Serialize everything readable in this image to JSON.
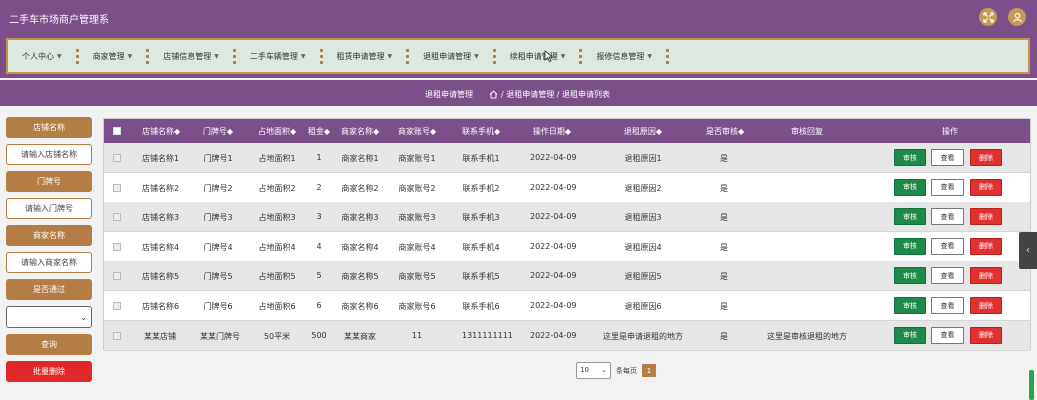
{
  "app": {
    "title": "二手车市场商户管理系"
  },
  "top_icons": [
    "fullscreen-icon",
    "user-icon"
  ],
  "nav": [
    {
      "label": "个人中心"
    },
    {
      "label": "商家管理"
    },
    {
      "label": "店铺信息管理"
    },
    {
      "label": "二手车辆管理"
    },
    {
      "label": "租赁申请管理"
    },
    {
      "label": "退租申请管理"
    },
    {
      "label": "续租申请管理"
    },
    {
      "label": "报修信息管理"
    }
  ],
  "breadcrumb": {
    "section": "退租申请管理",
    "path": "/ 退租申请管理 / 退租申请列表"
  },
  "search": {
    "shop_name_label": "店铺名称",
    "shop_name_placeholder": "请输入店铺名称",
    "door_no_label": "门牌号",
    "door_no_placeholder": "请输入门牌号",
    "merchant_name_label": "商家名称",
    "merchant_name_placeholder": "请输入商家名称",
    "passed_label": "是否通过",
    "passed_value": "",
    "query_button": "查询",
    "batch_delete_button": "批量删除"
  },
  "table": {
    "columns": [
      "店铺名称◆",
      "门牌号◆",
      "占地面积◆",
      "租金◆",
      "商家名称◆",
      "商家账号◆",
      "联系手机◆",
      "操作日期◆",
      "退租原因◆",
      "是否审核◆",
      "审核回复",
      "操作"
    ],
    "rows": [
      [
        "店铺名称1",
        "门牌号1",
        "占地面积1",
        "1",
        "商家名称1",
        "商家账号1",
        "联系手机1",
        "2022-04-09",
        "退租原因1",
        "是",
        ""
      ],
      [
        "店铺名称2",
        "门牌号2",
        "占地面积2",
        "2",
        "商家名称2",
        "商家账号2",
        "联系手机2",
        "2022-04-09",
        "退租原因2",
        "是",
        ""
      ],
      [
        "店铺名称3",
        "门牌号3",
        "占地面积3",
        "3",
        "商家名称3",
        "商家账号3",
        "联系手机3",
        "2022-04-09",
        "退租原因3",
        "是",
        ""
      ],
      [
        "店铺名称4",
        "门牌号4",
        "占地面积4",
        "4",
        "商家名称4",
        "商家账号4",
        "联系手机4",
        "2022-04-09",
        "退租原因4",
        "是",
        ""
      ],
      [
        "店铺名称5",
        "门牌号5",
        "占地面积5",
        "5",
        "商家名称5",
        "商家账号5",
        "联系手机5",
        "2022-04-09",
        "退租原因5",
        "是",
        ""
      ],
      [
        "店铺名称6",
        "门牌号6",
        "占地面积6",
        "6",
        "商家名称6",
        "商家账号6",
        "联系手机6",
        "2022-04-09",
        "退租原因6",
        "是",
        ""
      ],
      [
        "某某店铺",
        "某某门牌号",
        "50平米",
        "500",
        "某某商家",
        "11",
        "1311111111",
        "2022-04-09",
        "这里是申请退租的地方",
        "是",
        "这里是审核退租的地方"
      ]
    ],
    "actions": {
      "audit": "审核",
      "view": "查看",
      "delete": "删除"
    }
  },
  "pager": {
    "page_size": "10",
    "per_page_label": "条每页",
    "current_page": "1"
  },
  "colors": {
    "theme_purple": "#7b4f8a",
    "accent_brown": "#b37d45",
    "audit_green": "#1e8a4a",
    "delete_red": "#e03131"
  }
}
